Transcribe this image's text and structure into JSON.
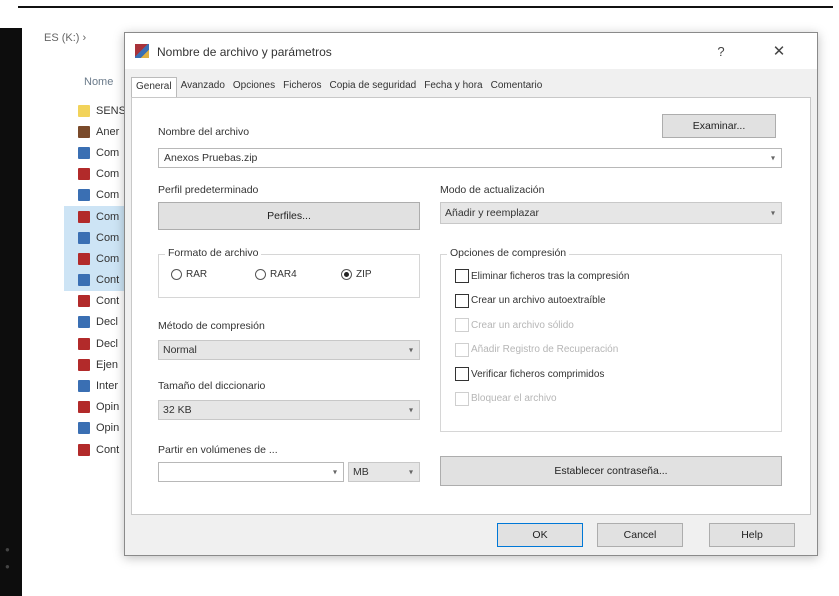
{
  "explorer": {
    "breadcrumb": "ES (K:) ›",
    "column_name": "Nome",
    "files": [
      {
        "label": "SENS",
        "icon": "text-file-icon",
        "type": "txt",
        "selected": false
      },
      {
        "label": "Aner",
        "icon": "winrar-archive-icon",
        "type": "exe",
        "selected": false
      },
      {
        "label": "Com",
        "icon": "document-icon",
        "type": "doc",
        "selected": false
      },
      {
        "label": "Com",
        "icon": "rar-file-icon",
        "type": "rar",
        "selected": false
      },
      {
        "label": "Com",
        "icon": "document-icon",
        "type": "doc",
        "selected": false
      },
      {
        "label": "Com",
        "icon": "rar-file-icon",
        "type": "rar",
        "selected": true
      },
      {
        "label": "Com",
        "icon": "document-icon",
        "type": "doc",
        "selected": true
      },
      {
        "label": "Com",
        "icon": "rar-file-icon",
        "type": "rar",
        "selected": true
      },
      {
        "label": "Cont",
        "icon": "document-icon",
        "type": "doc",
        "selected": true
      },
      {
        "label": "Cont",
        "icon": "rar-file-icon",
        "type": "rar",
        "selected": false
      },
      {
        "label": "Decl",
        "icon": "document-icon",
        "type": "doc",
        "selected": false
      },
      {
        "label": "Decl",
        "icon": "rar-file-icon",
        "type": "rar",
        "selected": false
      },
      {
        "label": "Ejen",
        "icon": "rar-file-icon",
        "type": "rar",
        "selected": false
      },
      {
        "label": "Inter",
        "icon": "document-icon",
        "type": "doc",
        "selected": false
      },
      {
        "label": "Opin",
        "icon": "rar-file-icon",
        "type": "rar",
        "selected": false
      },
      {
        "label": "Opin",
        "icon": "document-icon",
        "type": "doc",
        "selected": false
      },
      {
        "label": "Cont",
        "icon": "rar-file-icon",
        "type": "rar",
        "selected": false
      }
    ]
  },
  "dialog": {
    "title": "Nombre de archivo y parámetros",
    "help": "?",
    "close": "✕",
    "tabs": [
      "General",
      "Avanzado",
      "Opciones",
      "Ficheros",
      "Copia de seguridad",
      "Fecha y hora",
      "Comentario"
    ],
    "active_tab": 0,
    "archive_name_label": "Nombre del archivo",
    "archive_name_value": "Anexos Pruebas.zip",
    "browse_button": "Examinar...",
    "profile_label": "Perfil predeterminado",
    "profiles_button": "Perfiles...",
    "update_mode_label": "Modo de actualización",
    "update_mode_value": "Añadir y reemplazar",
    "archive_format": {
      "title": "Formato de archivo",
      "options": [
        "RAR",
        "RAR4",
        "ZIP"
      ],
      "selected": "ZIP"
    },
    "compression_method_label": "Método de compresión",
    "compression_method_value": "Normal",
    "dictionary_size_label": "Tamaño del diccionario",
    "dictionary_size_value": "32 KB",
    "split_label": "Partir en volúmenes de ...",
    "split_value": "",
    "split_unit": "MB",
    "options_group": {
      "title": "Opciones de compresión",
      "items": [
        {
          "label": "Eliminar ficheros tras la compresión",
          "checked": false,
          "enabled": true
        },
        {
          "label": "Crear un archivo autoextraíble",
          "checked": false,
          "enabled": true
        },
        {
          "label": "Crear un archivo sólido",
          "checked": false,
          "enabled": false
        },
        {
          "label": "Añadir Registro de Recuperación",
          "checked": false,
          "enabled": false
        },
        {
          "label": "Verificar ficheros comprimidos",
          "checked": false,
          "enabled": true
        },
        {
          "label": "Bloquear el archivo",
          "checked": false,
          "enabled": false
        }
      ]
    },
    "password_button": "Establecer contraseña...",
    "ok_button": "OK",
    "cancel_button": "Cancel",
    "help_button": "Help"
  },
  "colors": {
    "dialog_bg": "#f0f0f0",
    "panel_bg": "#ffffff",
    "button_bg": "#e1e1e1",
    "selection_bg": "#cde4f5",
    "focus_border": "#0078d7"
  }
}
